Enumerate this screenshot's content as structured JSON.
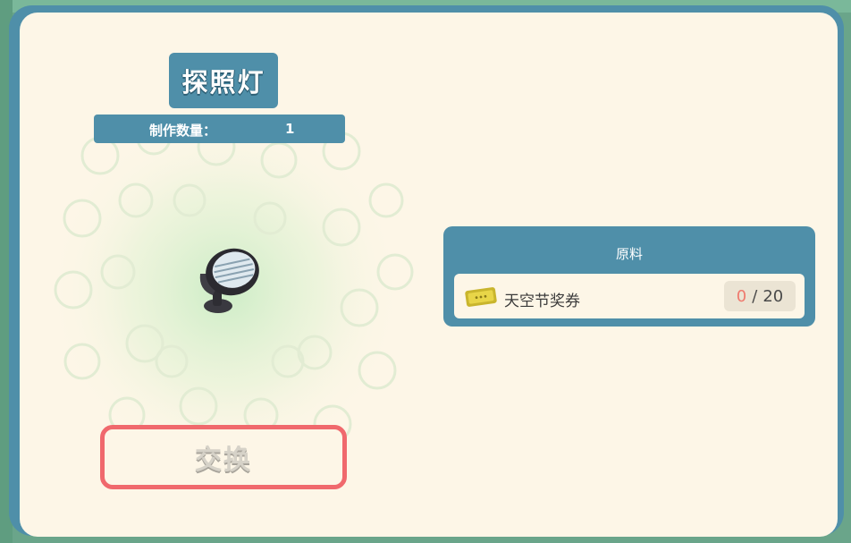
{
  "item": {
    "title": "探照灯",
    "quantity_label": "制作数量：",
    "quantity_value": "1",
    "icon": "spotlight-icon"
  },
  "exchange_button": {
    "label": "交换"
  },
  "materials": {
    "title": "原料",
    "rows": [
      {
        "icon": "ticket-icon",
        "name": "天空节奖券",
        "have": "0",
        "separator": "/",
        "need": "20"
      }
    ]
  },
  "colors": {
    "panel_blue": "#4f8fa9",
    "panel_cream": "#fdf6e7",
    "button_border": "#f0696d",
    "count_have": "#ef7a6e"
  }
}
